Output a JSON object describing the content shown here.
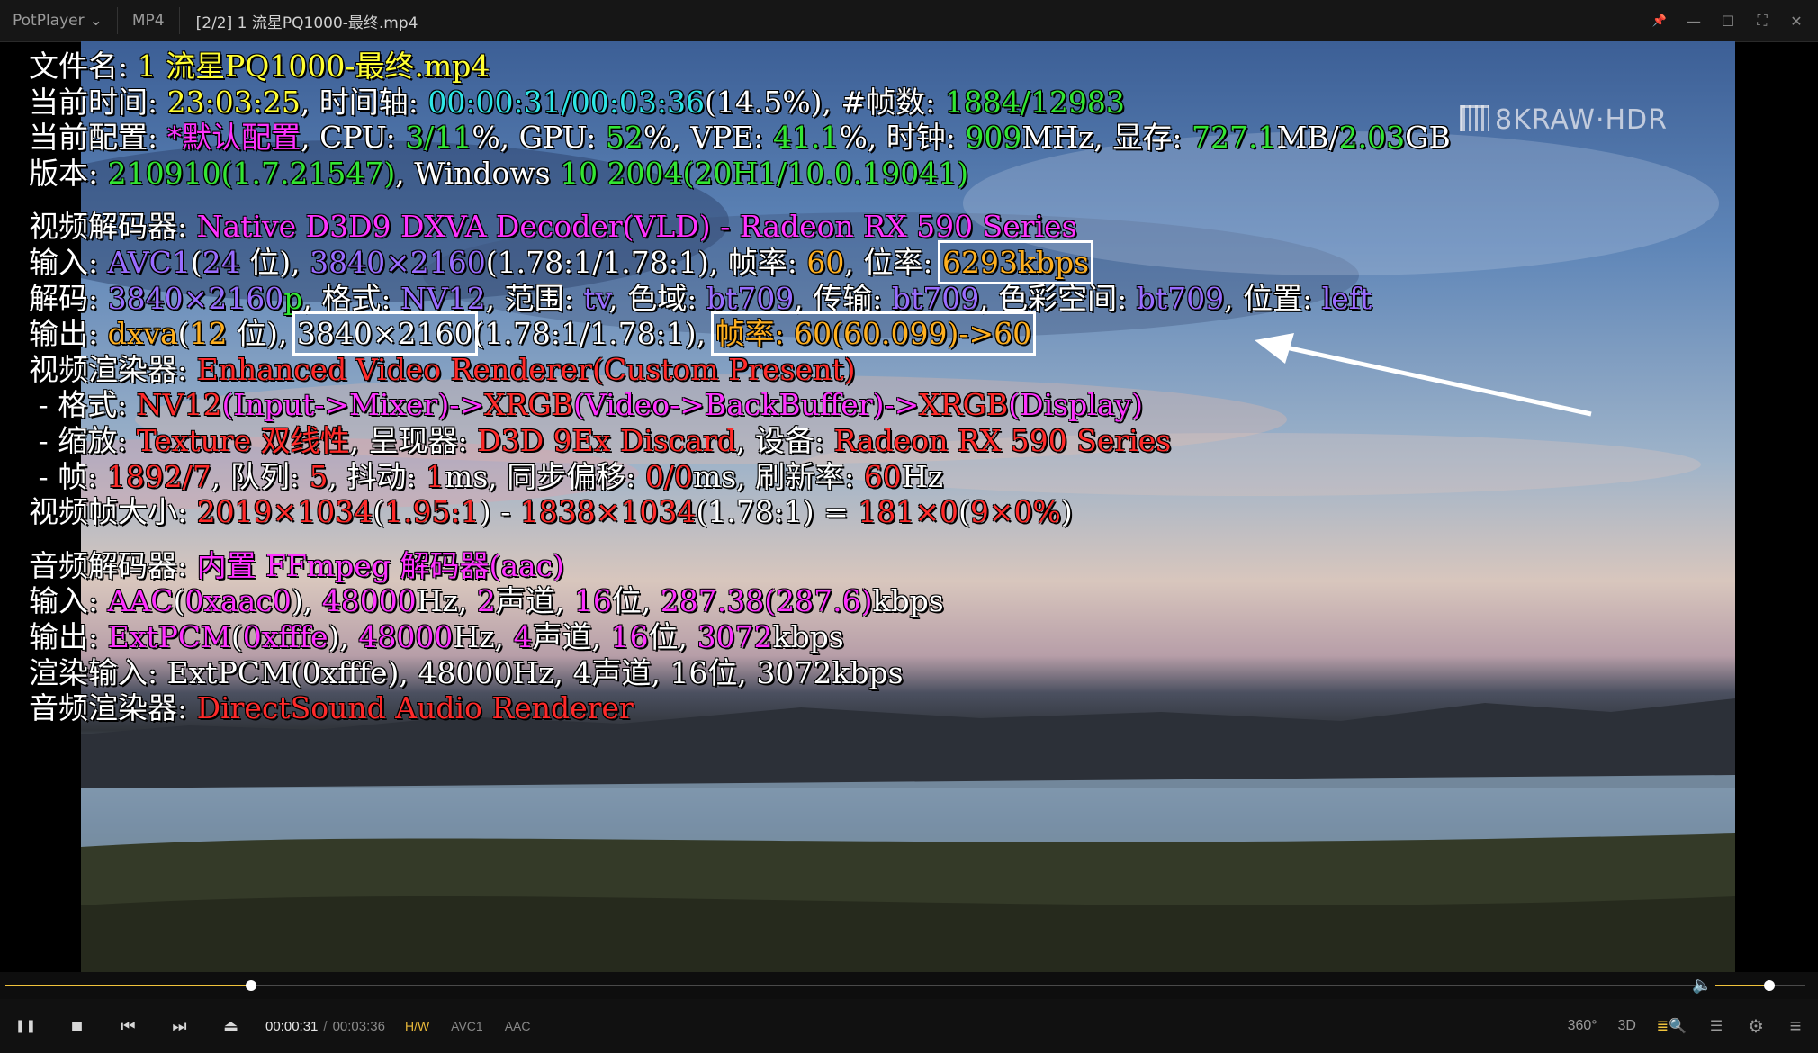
{
  "titlebar": {
    "app_name": "PotPlayer",
    "format_tag": "MP4",
    "file_title": "[2/2] 1 流星PQ1000-最终.mp4"
  },
  "watermark": "8KRAW·HDR",
  "osd": {
    "lines": [
      [
        {
          "t": "文件名: ",
          "c": "w"
        },
        {
          "t": "1 流星PQ1000-最终.mp4",
          "c": "y"
        }
      ],
      [
        {
          "t": "当前时间: ",
          "c": "w"
        },
        {
          "t": "23:03:25",
          "c": "y"
        },
        {
          "t": ", 时间轴: ",
          "c": "w"
        },
        {
          "t": "00:00:31/00:03:36",
          "c": "c"
        },
        {
          "t": "(14.5%), #帧数: ",
          "c": "w"
        },
        {
          "t": "1884/12983",
          "c": "g"
        }
      ],
      [
        {
          "t": "当前配置: ",
          "c": "w"
        },
        {
          "t": "*默认配置",
          "c": "m"
        },
        {
          "t": ", CPU: ",
          "c": "w"
        },
        {
          "t": "3/11",
          "c": "g"
        },
        {
          "t": "%, GPU: ",
          "c": "w"
        },
        {
          "t": "52",
          "c": "g"
        },
        {
          "t": "%, VPE: ",
          "c": "w"
        },
        {
          "t": "41.1",
          "c": "g"
        },
        {
          "t": "%, 时钟: ",
          "c": "w"
        },
        {
          "t": "909",
          "c": "g"
        },
        {
          "t": "MHz, 显存: ",
          "c": "w"
        },
        {
          "t": "727.1",
          "c": "g"
        },
        {
          "t": "MB/",
          "c": "w"
        },
        {
          "t": "2.03",
          "c": "g"
        },
        {
          "t": "GB",
          "c": "w"
        }
      ],
      [
        {
          "t": "版本: ",
          "c": "w"
        },
        {
          "t": "210910(1.7.21547)",
          "c": "g"
        },
        {
          "t": ", Windows ",
          "c": "w"
        },
        {
          "t": "10 2004(20H1/10.0.19041)",
          "c": "g"
        }
      ],
      "gap",
      [
        {
          "t": "视频解码器: ",
          "c": "w"
        },
        {
          "t": "Native D3D9 DXVA Decoder(VLD) - Radeon RX 590 Series",
          "c": "m"
        }
      ],
      [
        {
          "t": "输入: ",
          "c": "w"
        },
        {
          "t": "AVC1",
          "c": "v"
        },
        {
          "t": "(",
          "c": "w"
        },
        {
          "t": "24",
          "c": "v"
        },
        {
          "t": " 位), ",
          "c": "w"
        },
        {
          "t": "3840×2160",
          "c": "v"
        },
        {
          "t": "(1.78:1/1.78:1), 帧率: ",
          "c": "w"
        },
        {
          "t": "60",
          "c": "o"
        },
        {
          "t": ", 位率: ",
          "c": "w"
        },
        {
          "t": "6293kbps",
          "c": "o",
          "box": true
        }
      ],
      [
        {
          "t": "解码: ",
          "c": "w"
        },
        {
          "t": "3840×2160",
          "c": "v"
        },
        {
          "t": "p",
          "c": "g"
        },
        {
          "t": ", 格式: ",
          "c": "w"
        },
        {
          "t": "NV12",
          "c": "v"
        },
        {
          "t": ", 范围: ",
          "c": "w"
        },
        {
          "t": "tv",
          "c": "v"
        },
        {
          "t": ", 色域: ",
          "c": "w"
        },
        {
          "t": "bt709",
          "c": "v"
        },
        {
          "t": ", 传输: ",
          "c": "w"
        },
        {
          "t": "bt709",
          "c": "v"
        },
        {
          "t": ", 色彩空间: ",
          "c": "w"
        },
        {
          "t": "bt709",
          "c": "v"
        },
        {
          "t": ", 位置: ",
          "c": "w"
        },
        {
          "t": "left",
          "c": "v"
        }
      ],
      [
        {
          "t": "输出: ",
          "c": "w"
        },
        {
          "t": "dxva",
          "c": "o"
        },
        {
          "t": "(",
          "c": "w"
        },
        {
          "t": "12",
          "c": "o"
        },
        {
          "t": " 位), ",
          "c": "w"
        },
        {
          "t": "3840×2160",
          "c": "w",
          "box": true
        },
        {
          "t": "(1.78:1/1.78:1), ",
          "c": "w"
        },
        {
          "t": "帧率: 60(60.099)->60",
          "c": "o",
          "box": true
        }
      ],
      [
        {
          "t": "视频渲染器: ",
          "c": "w"
        },
        {
          "t": "Enhanced Video Renderer(Custom Present)",
          "c": "r"
        }
      ],
      [
        {
          "t": " - 格式: ",
          "c": "w"
        },
        {
          "t": "NV12",
          "c": "r"
        },
        {
          "t": "(Input->Mixer)->",
          "c": "m"
        },
        {
          "t": "XRGB",
          "c": "r"
        },
        {
          "t": "(Video->BackBuffer)->",
          "c": "m"
        },
        {
          "t": "XRGB",
          "c": "r"
        },
        {
          "t": "(Display)",
          "c": "m"
        }
      ],
      [
        {
          "t": " - 缩放: ",
          "c": "w"
        },
        {
          "t": "Texture 双线性",
          "c": "r"
        },
        {
          "t": ", 呈现器: ",
          "c": "w"
        },
        {
          "t": "D3D 9Ex Discard",
          "c": "r"
        },
        {
          "t": ", 设备: ",
          "c": "w"
        },
        {
          "t": "Radeon RX 590 Series",
          "c": "r"
        }
      ],
      [
        {
          "t": " - 帧: ",
          "c": "w"
        },
        {
          "t": "1892/7",
          "c": "r"
        },
        {
          "t": ", 队列: ",
          "c": "w"
        },
        {
          "t": "5",
          "c": "r"
        },
        {
          "t": ", 抖动: ",
          "c": "w"
        },
        {
          "t": "1",
          "c": "r"
        },
        {
          "t": "ms, 同步偏移: ",
          "c": "w"
        },
        {
          "t": "0/0",
          "c": "r"
        },
        {
          "t": "ms, 刷新率: ",
          "c": "w"
        },
        {
          "t": "60",
          "c": "r"
        },
        {
          "t": "Hz",
          "c": "w"
        }
      ],
      [
        {
          "t": "视频帧大小: ",
          "c": "w"
        },
        {
          "t": "2019×1034",
          "c": "r"
        },
        {
          "t": "(",
          "c": "w"
        },
        {
          "t": "1.95:1",
          "c": "r"
        },
        {
          "t": ") - ",
          "c": "w"
        },
        {
          "t": "1838×1034",
          "c": "r"
        },
        {
          "t": "(1.78:1) = ",
          "c": "w"
        },
        {
          "t": "181×0",
          "c": "r"
        },
        {
          "t": "(",
          "c": "w"
        },
        {
          "t": "9×0%",
          "c": "r"
        },
        {
          "t": ")",
          "c": "w"
        }
      ],
      "gap",
      [
        {
          "t": "音频解码器: ",
          "c": "w"
        },
        {
          "t": "内置 FFmpeg 解码器(aac)",
          "c": "m"
        }
      ],
      [
        {
          "t": "输入: ",
          "c": "w"
        },
        {
          "t": "AAC",
          "c": "m"
        },
        {
          "t": "(",
          "c": "w"
        },
        {
          "t": "0xaac0",
          "c": "m"
        },
        {
          "t": "), ",
          "c": "w"
        },
        {
          "t": "48000",
          "c": "m"
        },
        {
          "t": "Hz, ",
          "c": "w"
        },
        {
          "t": "2",
          "c": "m"
        },
        {
          "t": "声道, ",
          "c": "w"
        },
        {
          "t": "16",
          "c": "m"
        },
        {
          "t": "位, ",
          "c": "w"
        },
        {
          "t": "287.38(287.6)",
          "c": "m"
        },
        {
          "t": "kbps",
          "c": "w"
        }
      ],
      [
        {
          "t": "输出: ",
          "c": "w"
        },
        {
          "t": "ExtPCM",
          "c": "m"
        },
        {
          "t": "(",
          "c": "w"
        },
        {
          "t": "0xfffe",
          "c": "m"
        },
        {
          "t": "), ",
          "c": "w"
        },
        {
          "t": "48000",
          "c": "m"
        },
        {
          "t": "Hz, ",
          "c": "w"
        },
        {
          "t": "4",
          "c": "m"
        },
        {
          "t": "声道, ",
          "c": "w"
        },
        {
          "t": "16",
          "c": "m"
        },
        {
          "t": "位, ",
          "c": "w"
        },
        {
          "t": "3072",
          "c": "m"
        },
        {
          "t": "kbps",
          "c": "w"
        }
      ],
      [
        {
          "t": "渲染输入: ",
          "c": "w"
        },
        {
          "t": "ExtPCM(0xfffe), 48000Hz, 4声道, 16位, 3072kbps",
          "c": "w"
        }
      ],
      [
        {
          "t": "音频渲染器: ",
          "c": "w"
        },
        {
          "t": "DirectSound Audio Renderer",
          "c": "r"
        }
      ]
    ]
  },
  "playback": {
    "progress": 0.145,
    "volume": 0.6,
    "time_current": "00:00:31",
    "time_separator": "/",
    "time_total": "00:03:36",
    "hw_tag": "H/W",
    "video_codec_tag": "AVC1",
    "audio_codec_tag": "AAC"
  },
  "controls": {
    "pause": "❚❚",
    "stop": "■",
    "prev": "⏮",
    "next": "⏭",
    "eject": "⏏",
    "vr360": "360°",
    "mode3d": "3D",
    "subtitle_search": "≣🔍",
    "playlist": "☰",
    "settings": "⚙",
    "menu": "≡",
    "volume_icon": "🔈"
  },
  "window_controls": {
    "pin": "📌",
    "minimize": "—",
    "maximize": "☐",
    "fullscreen": "⛶",
    "close": "✕"
  },
  "colors": {
    "accent": "#f0c33c",
    "titlebar_bg": "#161616"
  }
}
